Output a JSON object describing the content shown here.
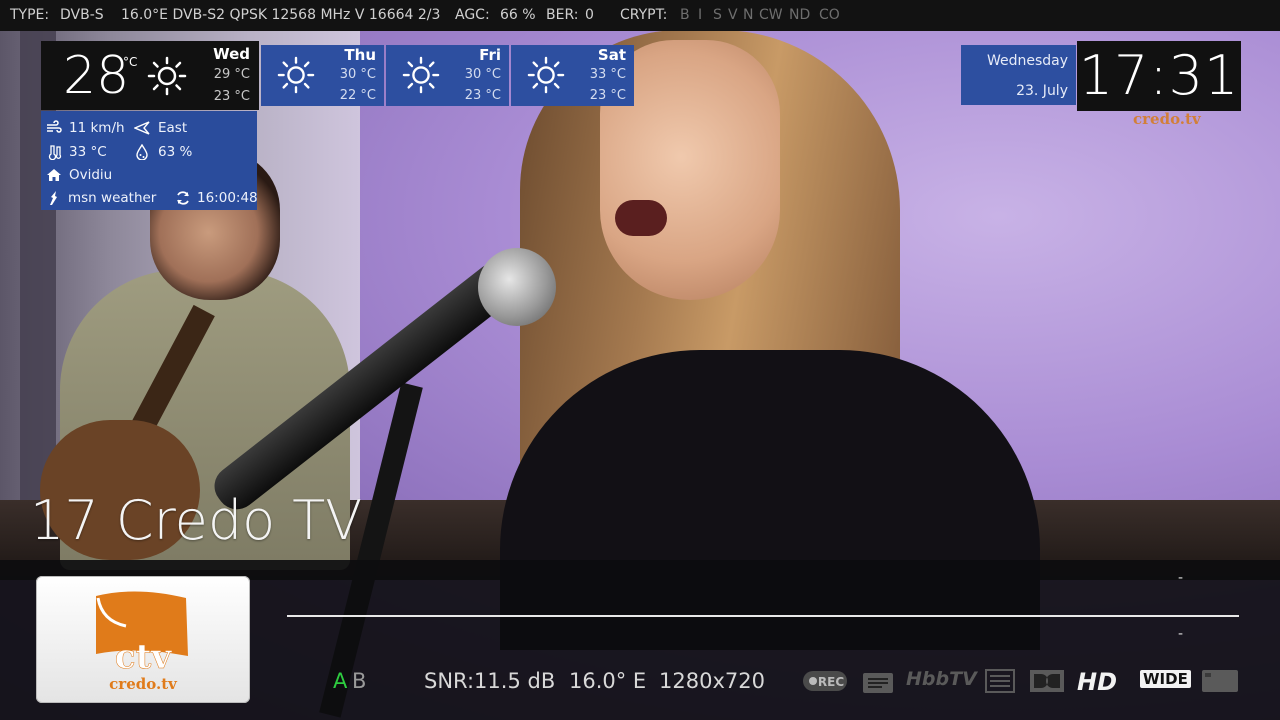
{
  "topbar": {
    "type": "TYPE:",
    "type_value": "DVB-S",
    "transponder": "16.0°E DVB-S2 QPSK 12568 MHz V 16664 2/3",
    "agc_label": "AGC:",
    "agc_value": "66 %",
    "ber_label": "BER:",
    "ber_value": "0",
    "crypt_label": "CRYPT:",
    "crypt_flags": [
      "B",
      "I",
      "S",
      "V",
      "N",
      "CW",
      "ND",
      "CO"
    ]
  },
  "weather": {
    "today": {
      "temp": "28",
      "unit": "°C",
      "day": "Wed",
      "high": "29 °C",
      "low": "23 °C",
      "icon": "sun-icon"
    },
    "forecast": [
      {
        "day": "Thu",
        "high": "30 °C",
        "low": "22 °C",
        "icon": "sun-icon"
      },
      {
        "day": "Fri",
        "high": "30 °C",
        "low": "23 °C",
        "icon": "sun-icon"
      },
      {
        "day": "Sat",
        "high": "33 °C",
        "low": "23 °C",
        "icon": "sun-icon"
      }
    ],
    "details": {
      "wind_speed": "11 km/h",
      "wind_direction": "East",
      "feels_like": "33 °C",
      "humidity": "63 %",
      "location": "Ovidiu",
      "provider": "msn weather",
      "updated": "16:00:48"
    }
  },
  "datetime": {
    "weekday": "Wednesday",
    "date": "23. July",
    "time": "17:31"
  },
  "watermark": "credo.tv",
  "channel": {
    "name": "17 Credo TV",
    "logo_text": "ctv",
    "logo_sub": "credo.tv"
  },
  "epg": {
    "now_marker": "-",
    "next_marker": "-"
  },
  "audio": {
    "track_a": "A",
    "track_b": "B"
  },
  "tech": {
    "snr": "SNR:11.5 dB",
    "orbital": "16.0° E",
    "resolution": "1280x720"
  },
  "indicators": {
    "rec": "REC",
    "hbbtv": "HbbTV",
    "hd": "HD",
    "wide": "WIDE"
  },
  "colors": {
    "accent_blue": "#2d4fa0",
    "active_audio": "#2ecc40",
    "brand_orange": "#e07b1a"
  }
}
